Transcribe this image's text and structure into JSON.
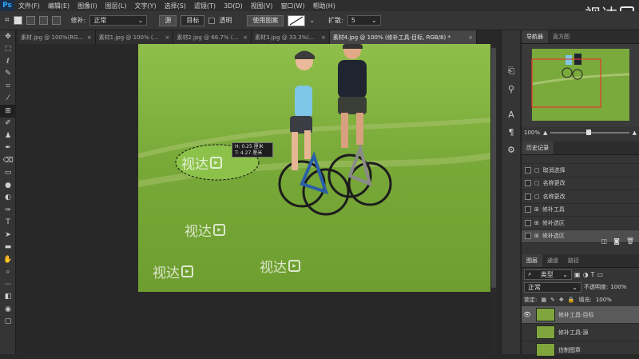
{
  "app": {
    "logo": "Ps"
  },
  "menu": [
    "文件(F)",
    "编辑(E)",
    "图像(I)",
    "图层(L)",
    "文字(Y)",
    "选择(S)",
    "滤镜(T)",
    "3D(D)",
    "视图(V)",
    "窗口(W)",
    "帮助(H)"
  ],
  "watermark": "视达",
  "options": {
    "repair_label": "修补:",
    "repair_mode": "正常",
    "source_label": "源",
    "target_label": "目标",
    "transparent_label": "透明",
    "use_pattern": "使用图案",
    "diffusion_label": "扩散:",
    "diffusion_value": "5"
  },
  "tabs": [
    {
      "label": "素材.jpg @ 100%(RG...",
      "active": false
    },
    {
      "label": "素材1.jpg @ 100% (...",
      "active": false
    },
    {
      "label": "素材2.jpg @ 66.7% (...",
      "active": false
    },
    {
      "label": "素材3.jpg @ 33.3%(...",
      "active": false
    },
    {
      "label": "素材4.jpg @ 100% (修补工具-目标, RGB/8) *",
      "active": true
    }
  ],
  "canvas": {
    "tooltip_w": "H: 0.25 厘米",
    "tooltip_h": "T: 4.27 厘米",
    "wm1": "视达",
    "wm2": "视达",
    "wm3": "视达",
    "wm4": "视达"
  },
  "navigator": {
    "tab1": "导航器",
    "tab2": "直方图",
    "zoom": "100%"
  },
  "history": {
    "title": "历史记录",
    "items": [
      "取消选择",
      "名称更改",
      "名称更改",
      "修补工具",
      "修补选区",
      "修补选区"
    ]
  },
  "layers": {
    "tabs": [
      "图层",
      "通道",
      "路径"
    ],
    "kind": "类型",
    "blend": "正常",
    "opacity_label": "不透明度:",
    "opacity": "100%",
    "lock_label": "锁定:",
    "fill_label": "填充:",
    "fill": "100%",
    "items": [
      "修补工具-目标",
      "修补工具-源",
      "仿制图章"
    ]
  },
  "colors": {
    "accent": "#31a8ff",
    "panel": "#353535",
    "nav_frame": "#e53a2b"
  }
}
